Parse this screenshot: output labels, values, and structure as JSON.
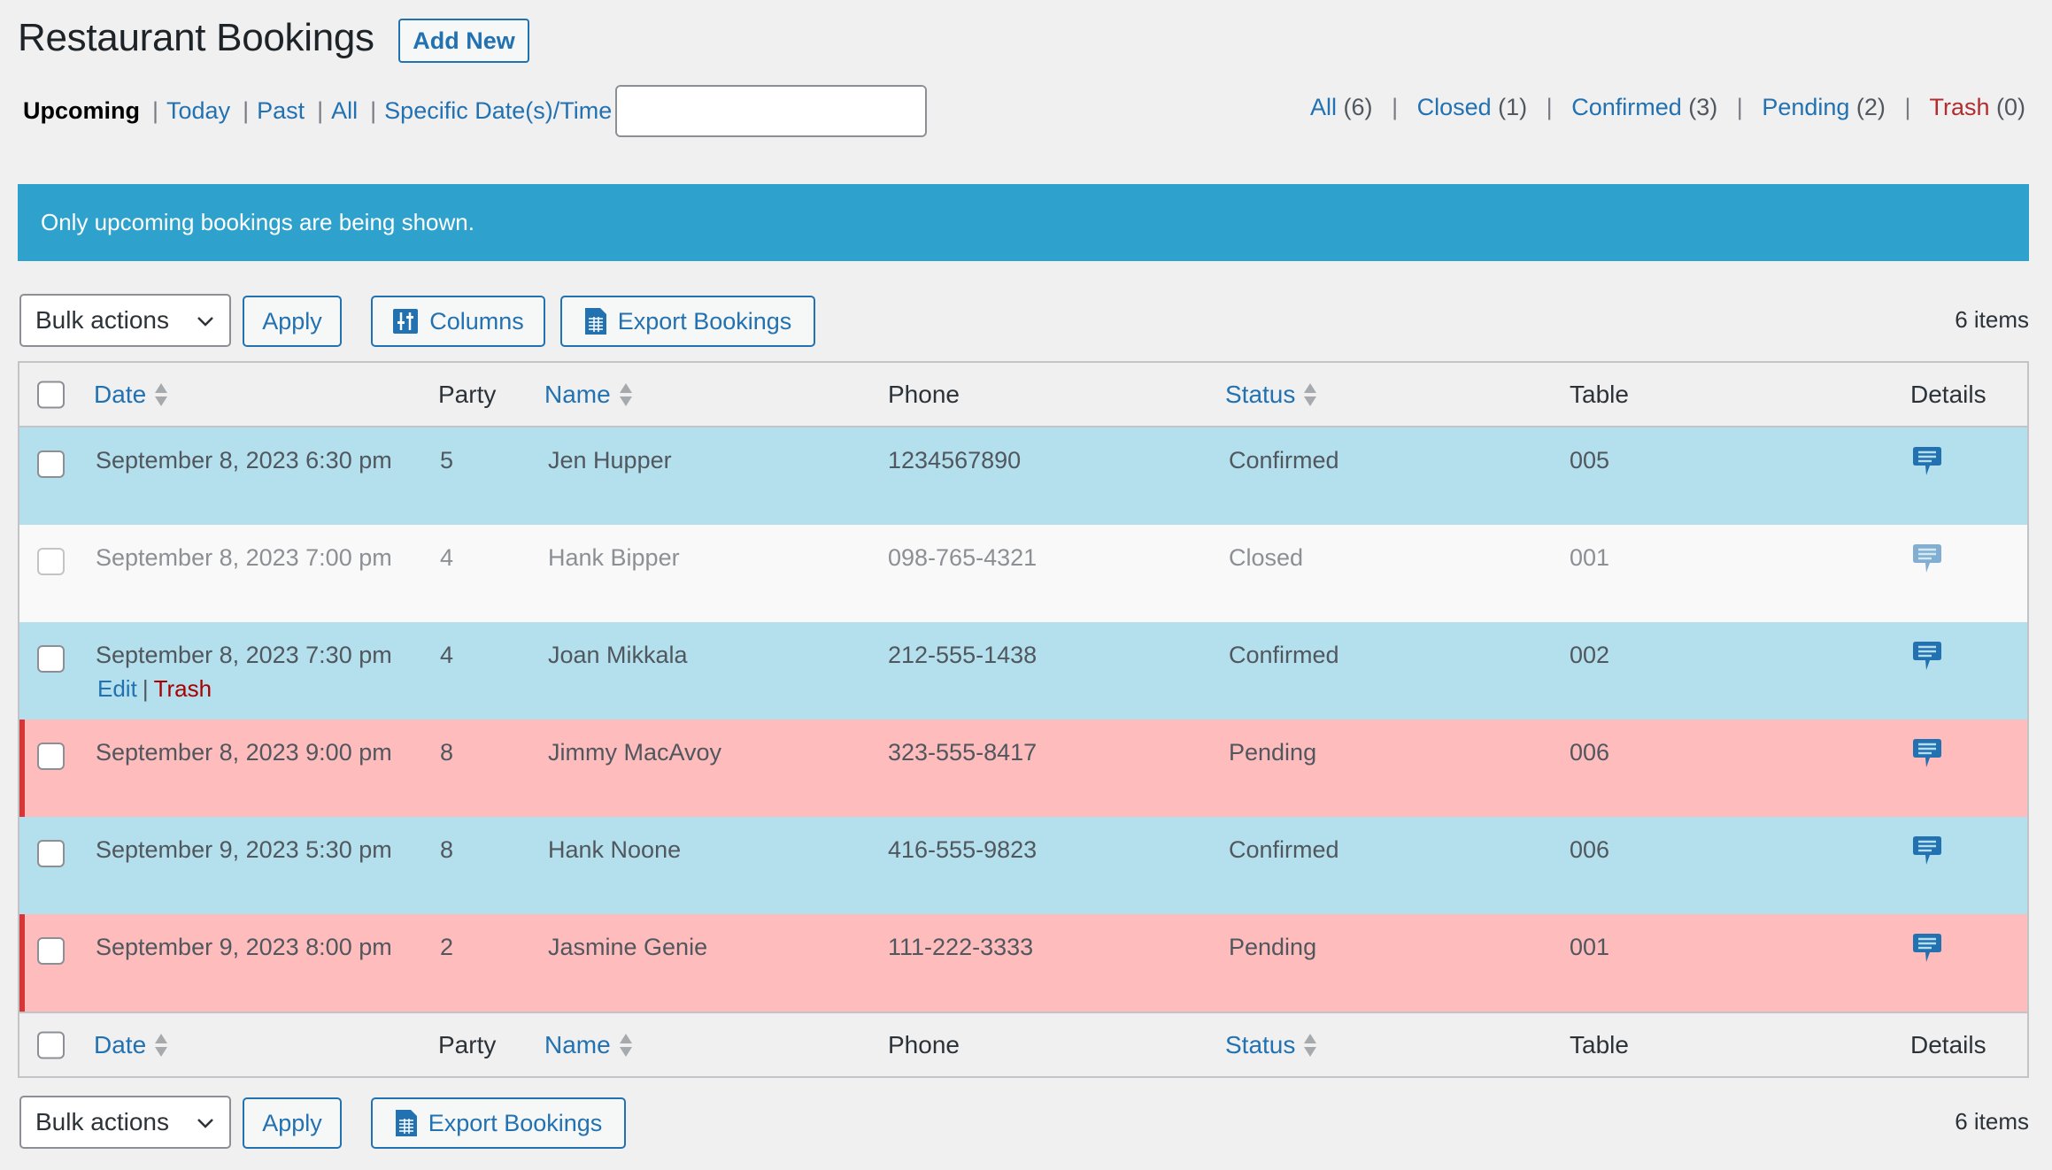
{
  "header": {
    "title": "Restaurant Bookings",
    "add_new_label": "Add New"
  },
  "date_filters": [
    {
      "label": "Upcoming",
      "current": true
    },
    {
      "label": "Today",
      "current": false
    },
    {
      "label": "Past",
      "current": false
    },
    {
      "label": "All",
      "current": false
    },
    {
      "label": "Specific Date(s)/Time",
      "current": false
    }
  ],
  "search": {
    "value": "",
    "placeholder": "",
    "icon": "search-icon"
  },
  "status_filters": [
    {
      "label": "All",
      "count": "(6)"
    },
    {
      "label": "Closed",
      "count": "(1)"
    },
    {
      "label": "Confirmed",
      "count": "(3)"
    },
    {
      "label": "Pending",
      "count": "(2)"
    },
    {
      "label": "Trash",
      "count": "(0)"
    }
  ],
  "notice": "Only upcoming bookings are being shown.",
  "toolbar_top": {
    "bulk_actions": "Bulk actions",
    "apply": "Apply",
    "columns": "Columns",
    "export": "Export Bookings",
    "items": "6 items"
  },
  "toolbar_bottom": {
    "bulk_actions": "Bulk actions",
    "apply": "Apply",
    "export": "Export Bookings",
    "items": "6 items"
  },
  "columns": {
    "date": "Date",
    "party": "Party",
    "name": "Name",
    "phone": "Phone",
    "status": "Status",
    "table": "Table",
    "details": "Details"
  },
  "row_actions": {
    "edit": "Edit",
    "trash": "Trash"
  },
  "colors": {
    "link": "#2271b1",
    "notice": "#2ea2cc",
    "confirmed_row": "#b4dfec",
    "pending_row": "#ffbcbc",
    "pending_border": "#d63638",
    "closed_row": "#f9f9f9",
    "trash": "#b32d2e"
  },
  "rows": [
    {
      "date": "September 8, 2023 6:30 pm",
      "party": "5",
      "name": "Jen Hupper",
      "phone": "1234567890",
      "status": "Confirmed",
      "table": "005",
      "show_actions": false
    },
    {
      "date": "September 8, 2023 7:00 pm",
      "party": "4",
      "name": "Hank Bipper",
      "phone": "098-765-4321",
      "status": "Closed",
      "table": "001",
      "show_actions": false
    },
    {
      "date": "September 8, 2023 7:30 pm",
      "party": "4",
      "name": "Joan Mikkala",
      "phone": "212-555-1438",
      "status": "Confirmed",
      "table": "002",
      "show_actions": true
    },
    {
      "date": "September 8, 2023 9:00 pm",
      "party": "8",
      "name": "Jimmy MacAvoy",
      "phone": "323-555-8417",
      "status": "Pending",
      "table": "006",
      "show_actions": false
    },
    {
      "date": "September 9, 2023 5:30 pm",
      "party": "8",
      "name": "Hank Noone",
      "phone": "416-555-9823",
      "status": "Confirmed",
      "table": "006",
      "show_actions": false
    },
    {
      "date": "September 9, 2023 8:00 pm",
      "party": "2",
      "name": "Jasmine Genie",
      "phone": "111-222-3333",
      "status": "Pending",
      "table": "001",
      "show_actions": false
    }
  ]
}
